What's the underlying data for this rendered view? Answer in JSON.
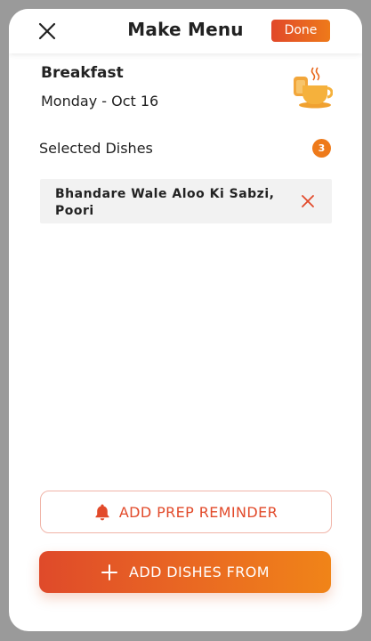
{
  "header": {
    "title": "Make Menu",
    "done_label": "Done"
  },
  "meal": {
    "name": "Breakfast",
    "date": "Monday - Oct 16",
    "icon": "breakfast-cup-icon"
  },
  "selected": {
    "label": "Selected Dishes",
    "count": "3",
    "dishes": [
      {
        "name": "Bhandare Wale Aloo Ki Sabzi, Poori"
      }
    ]
  },
  "actions": {
    "reminder_label": "ADD PREP REMINDER",
    "add_dishes_label": "ADD DISHES FROM"
  },
  "colors": {
    "accent": "#e24a2a",
    "accent_end": "#f08418",
    "badge": "#ee7a1a"
  }
}
